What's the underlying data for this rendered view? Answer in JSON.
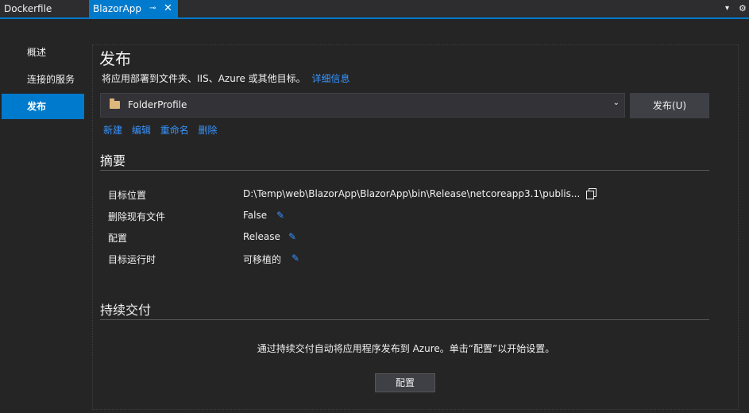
{
  "tabs": {
    "docker": "Dockerfile",
    "active": "BlazorApp",
    "pin_glyph": "⊸",
    "close_glyph": "✕"
  },
  "strip": {
    "dropdown_glyph": "▾",
    "gear_glyph": "⚙"
  },
  "sidebar": {
    "items": [
      {
        "label": "概述"
      },
      {
        "label": "连接的服务"
      },
      {
        "label": "发布"
      }
    ]
  },
  "publish": {
    "title": "发布",
    "description": "将应用部署到文件夹、IIS、Azure 或其他目标。",
    "details_link": "详细信息",
    "profile": "FolderProfile",
    "publish_button": "发布(U)",
    "actions": [
      "新建",
      "编辑",
      "重命名",
      "删除"
    ]
  },
  "summary": {
    "title": "摘要",
    "rows": [
      {
        "label": "目标位置",
        "value": "D:\\Temp\\web\\BlazorApp\\BlazorApp\\bin\\Release\\netcoreapp3.1\\publis..."
      },
      {
        "label": "删除现有文件",
        "value": "False"
      },
      {
        "label": "配置",
        "value": "Release"
      },
      {
        "label": "目标运行时",
        "value": "可移植的"
      }
    ]
  },
  "continuous_delivery": {
    "title": "持续交付",
    "text": "通过持续交付自动将应用程序发布到 Azure。单击“配置”以开始设置。",
    "button": "配置"
  },
  "icons": {
    "folder": "folder-icon",
    "pencil": "pencil-icon",
    "copy": "copy-icon"
  },
  "colors": {
    "accent": "#007acc",
    "link": "#3794ff",
    "background": "#252526"
  }
}
